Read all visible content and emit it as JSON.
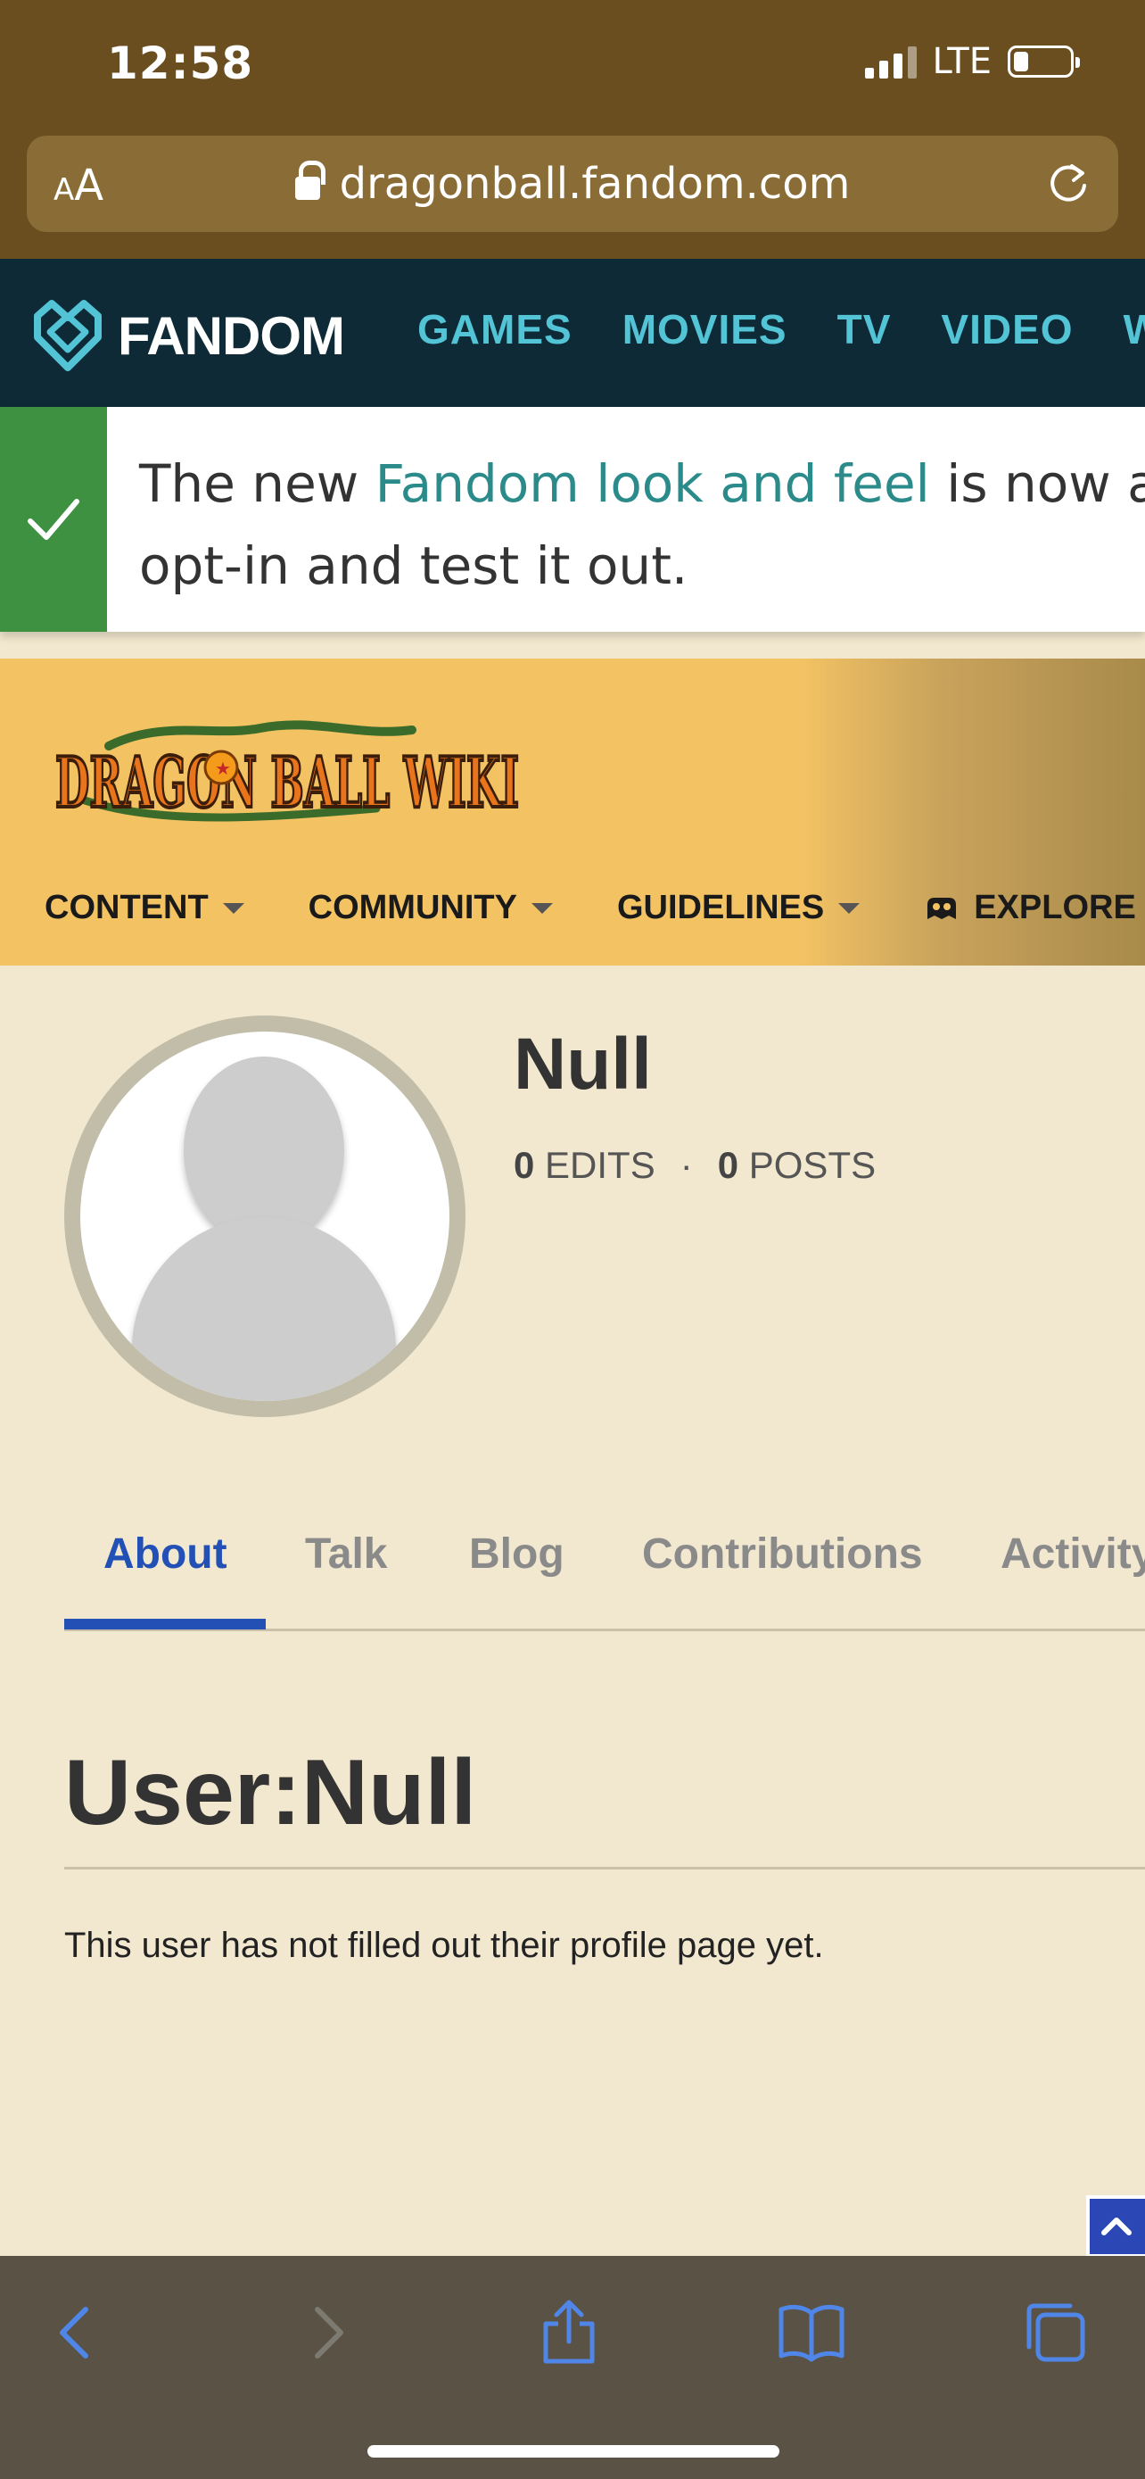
{
  "status_bar": {
    "time": "12:58",
    "network": "LTE"
  },
  "browser": {
    "text_size_label_small": "A",
    "text_size_label_large": "A",
    "url": "dragonball.fandom.com"
  },
  "fandom_nav": {
    "brand": "FANDOM",
    "links": [
      "GAMES",
      "MOVIES",
      "TV",
      "VIDEO",
      "W"
    ]
  },
  "banner": {
    "text_before": "The new ",
    "link_text": "Fandom look and feel",
    "text_after": " is now av",
    "line2": "opt-in and test it out."
  },
  "wiki": {
    "logo_text": "DRAGON BALL WIKI",
    "menu": [
      "CONTENT",
      "COMMUNITY",
      "GUIDELINES",
      "EXPLORE"
    ]
  },
  "profile": {
    "name": "Null",
    "edits_count": "0",
    "edits_label": "EDITS",
    "posts_count": "0",
    "posts_label": "POSTS",
    "separator": "·"
  },
  "tabs": [
    "About",
    "Talk",
    "Blog",
    "Contributions",
    "Activity"
  ],
  "active_tab": "About",
  "content": {
    "title": "User:Null",
    "body": "This user has not filled out their profile page yet."
  },
  "colors": {
    "page_bg": "#f2e8cf",
    "fandom_nav_bg": "#0e2a36",
    "fandom_link": "#52c4d6",
    "wiki_header_bg": "#f2c263",
    "active_tab": "#2250b5",
    "banner_check": "#3f9142"
  }
}
